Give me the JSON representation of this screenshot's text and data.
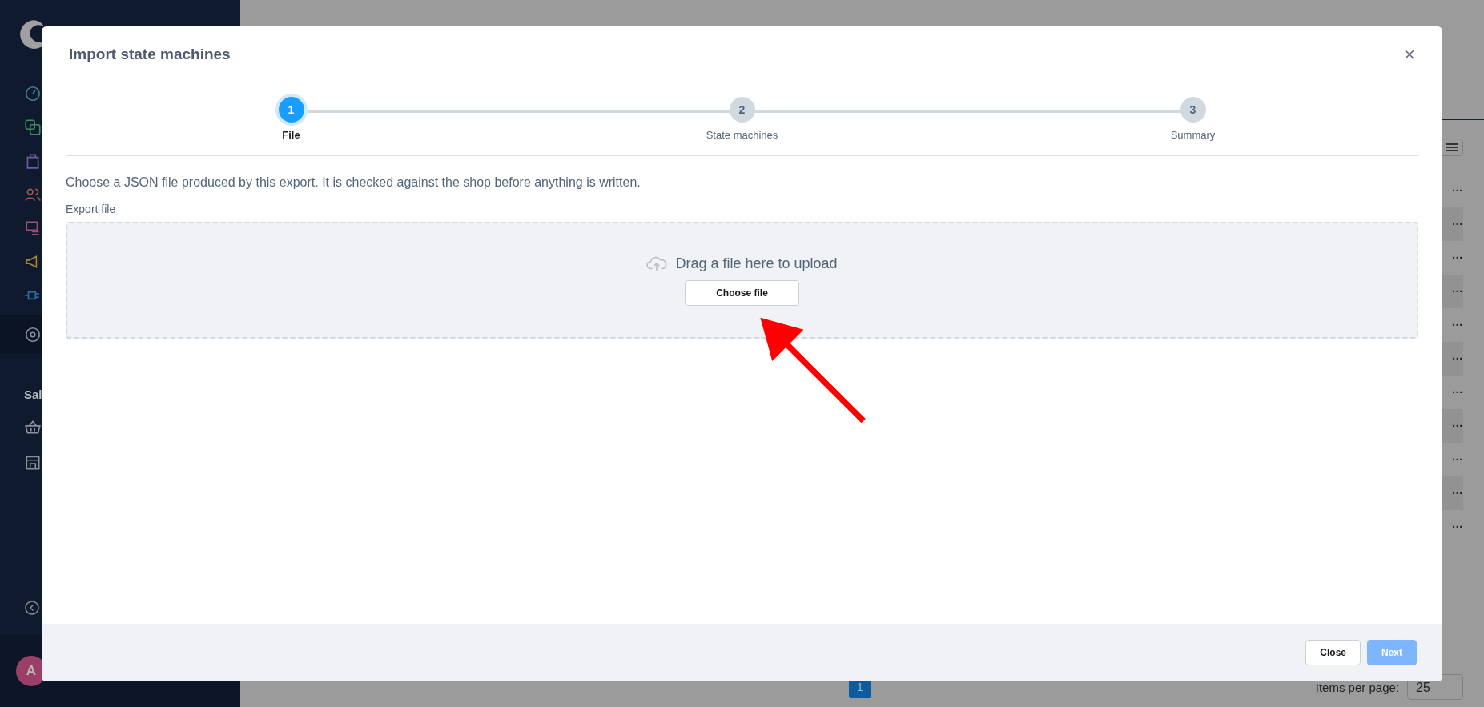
{
  "sidebar": {
    "section_label": "Sal",
    "avatar_initial": "A"
  },
  "table": {
    "row_actions": [
      "···",
      "···",
      "···",
      "···",
      "···",
      "···",
      "···",
      "···",
      "···",
      "···",
      "···"
    ]
  },
  "pagination": {
    "current_page": "1",
    "items_per_page_label": "Items per page:",
    "items_per_page_value": "25"
  },
  "dialog": {
    "title": "Import state machines",
    "steps": [
      {
        "number": "1",
        "label": "File",
        "selected": true
      },
      {
        "number": "2",
        "label": "State machines",
        "selected": false
      },
      {
        "number": "3",
        "label": "Summary",
        "selected": false
      }
    ],
    "description": "Choose a JSON file produced by this export. It is checked against the shop before anything is written.",
    "field_label": "Export file",
    "dropzone_text": "Drag a file here to upload",
    "choose_button": "Choose file",
    "buttons": [
      {
        "label": "Close",
        "kind": "secondary",
        "disabled": false
      },
      {
        "label": "Next",
        "kind": "primary",
        "disabled": true
      }
    ]
  }
}
